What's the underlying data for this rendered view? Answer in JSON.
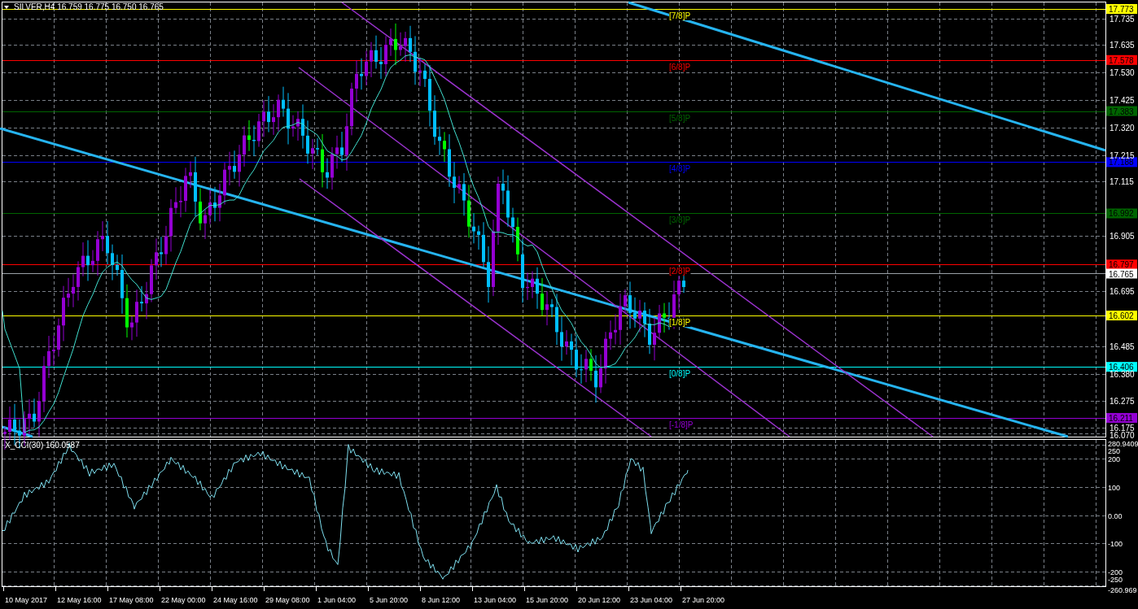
{
  "chart": {
    "header": "SILVER,H4  16.759 16.775 16.750 16.765",
    "levels": [
      {
        "label": "[7/8]P",
        "price": "17.773",
        "color": "#ffff00"
      },
      {
        "label": "[6/8]P",
        "price": "17.578",
        "color": "#ff0000"
      },
      {
        "label": "[5/8]P",
        "price": "17.383",
        "color": "#006400"
      },
      {
        "label": "[4/8]P",
        "price": "17.188",
        "color": "#0000ff"
      },
      {
        "label": "[3/8]P",
        "price": "16.992",
        "color": "#006400"
      },
      {
        "label": "[2/8]P",
        "price": "16.797",
        "color": "#ff0000"
      },
      {
        "label": "[1/8]P",
        "price": "16.602",
        "color": "#ffff00"
      },
      {
        "label": "[0/8]P",
        "price": "16.406",
        "color": "#00ffff"
      },
      {
        "label": "[-1/8]P",
        "price": "16.211",
        "color": "#9400d3"
      }
    ],
    "current_price": "16.765",
    "price_ticks": [
      "17.735",
      "17.635",
      "17.530",
      "17.425",
      "17.320",
      "17.215",
      "17.115",
      "16.905",
      "16.695",
      "16.485",
      "16.380",
      "16.275",
      "16.175",
      "16.070"
    ],
    "indicator": {
      "title": "X_CCI(30) 160.0587",
      "max_label": "280.9409",
      "min_label": "-260.969",
      "ticks": [
        "250",
        "200",
        "100",
        "0.00",
        "-100",
        "-200",
        "-250"
      ]
    },
    "time_labels": [
      "10 May 2017",
      "12 May 16:00",
      "17 May 08:00",
      "22 May 00:00",
      "24 May 16:00",
      "29 May 08:00",
      "1 Jun 04:00",
      "5 Jun 20:00",
      "8 Jun 12:00",
      "13 Jun 04:00",
      "15 Jun 20:00",
      "20 Jun 12:00",
      "23 Jun 04:00",
      "27 Jun 20:00"
    ]
  }
}
